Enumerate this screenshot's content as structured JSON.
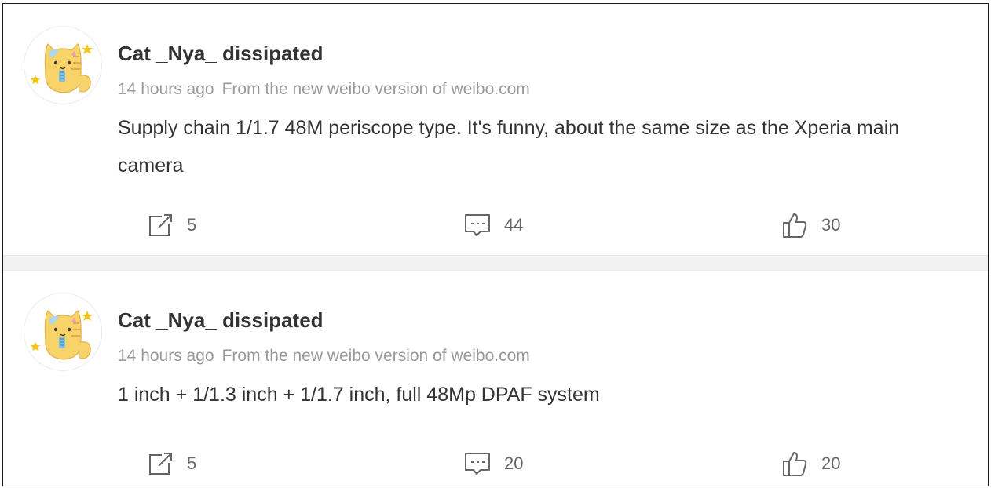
{
  "posts": [
    {
      "avatar_icon": "cat-avatar-icon",
      "username": "Cat _Nya_ dissipated",
      "time": "14 hours ago",
      "source": "From the new weibo version of weibo.com",
      "content": "Supply chain 1/1.7 48M periscope type. It's funny, about the same size as the Xperia main camera",
      "reposts": "5",
      "comments": "44",
      "likes": "30"
    },
    {
      "avatar_icon": "cat-avatar-icon",
      "username": "Cat _Nya_ dissipated",
      "time": "14 hours ago",
      "source": "From the new weibo version of weibo.com",
      "content": "1 inch + 1/1.3 inch + 1/1.7 inch, full 48Mp DPAF system",
      "reposts": "5",
      "comments": "20",
      "likes": "20"
    }
  ],
  "icons": {
    "repost": "repost-icon",
    "comment": "comment-icon",
    "like": "thumbs-up-icon"
  },
  "colors": {
    "username": "#333333",
    "meta": "#999999",
    "icon": "#666666",
    "separator": "#f2f2f2",
    "avatar_cat": "#f7d36a",
    "avatar_star": "#f5c518"
  }
}
